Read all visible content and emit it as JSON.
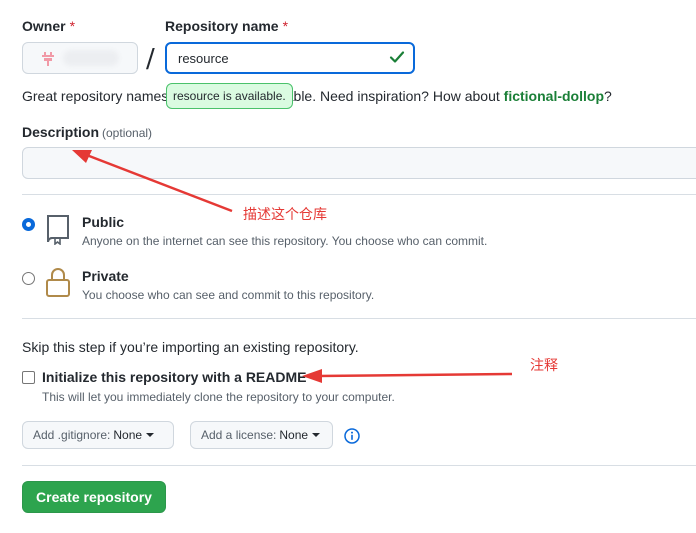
{
  "owner": {
    "label": "Owner",
    "required_mark": "*"
  },
  "repo_name": {
    "label": "Repository name",
    "required_mark": "*",
    "value": "resource"
  },
  "separator": "/",
  "hint": {
    "prefix": "Great repository names",
    "middle": "orable. Need inspiration? How about ",
    "suggestion": "fictional-dollop",
    "suffix": "?"
  },
  "availability_tip": "resource is available.",
  "description": {
    "label": "Description",
    "optional": "(optional)",
    "value": ""
  },
  "visibility": {
    "public": {
      "title": "Public",
      "desc": "Anyone on the internet can see this repository. You choose who can commit.",
      "selected": true
    },
    "private": {
      "title": "Private",
      "desc": "You choose who can see and commit to this repository.",
      "selected": false
    }
  },
  "init": {
    "skip_text": "Skip this step if you’re importing an existing repository.",
    "readme_label": "Initialize this repository with a README",
    "readme_desc": "This will let you immediately clone the repository to your computer.",
    "readme_checked": false
  },
  "gitignore": {
    "prefix": "Add .gitignore:",
    "value": "None"
  },
  "license": {
    "prefix": "Add a license:",
    "value": "None"
  },
  "create_button": "Create repository",
  "annotations": {
    "description": "描述这个仓库",
    "readme": "注释"
  },
  "colors": {
    "accent": "#0969da",
    "success": "#2da44e",
    "annotation": "#e53935"
  },
  "icons": {
    "owner_avatar": "identicon",
    "name_valid": "check-icon",
    "public": "repo-icon",
    "private": "lock-icon",
    "info": "info-icon"
  }
}
